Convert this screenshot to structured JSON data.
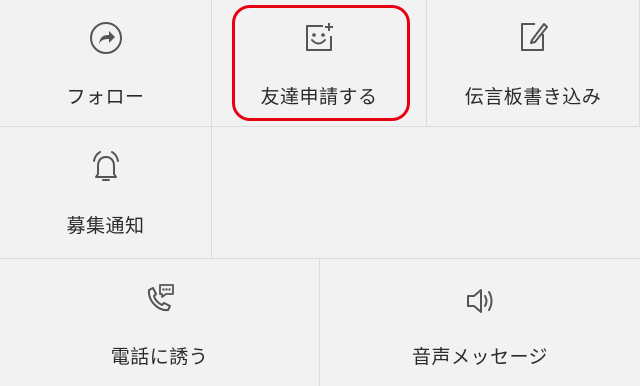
{
  "menu": {
    "items": [
      {
        "id": "follow",
        "label": "フォロー",
        "icon": "follow-arrow-icon"
      },
      {
        "id": "friend_request",
        "label": "友達申請する",
        "icon": "smiley-plus-icon"
      },
      {
        "id": "message_board",
        "label": "伝言板書き込み",
        "icon": "note-pencil-icon"
      },
      {
        "id": "recruit_notice",
        "label": "募集通知",
        "icon": "alarm-bell-icon"
      },
      {
        "id": "invite_call",
        "label": "電話に誘う",
        "icon": "phone-chat-icon"
      },
      {
        "id": "voice_message",
        "label": "音声メッセージ",
        "icon": "speaker-icon"
      }
    ]
  },
  "colors": {
    "background": "#f2f2f2",
    "divider": "#dcdcdc",
    "text": "#2b2b2b",
    "icon": "#555555",
    "highlight": "#e60012"
  }
}
